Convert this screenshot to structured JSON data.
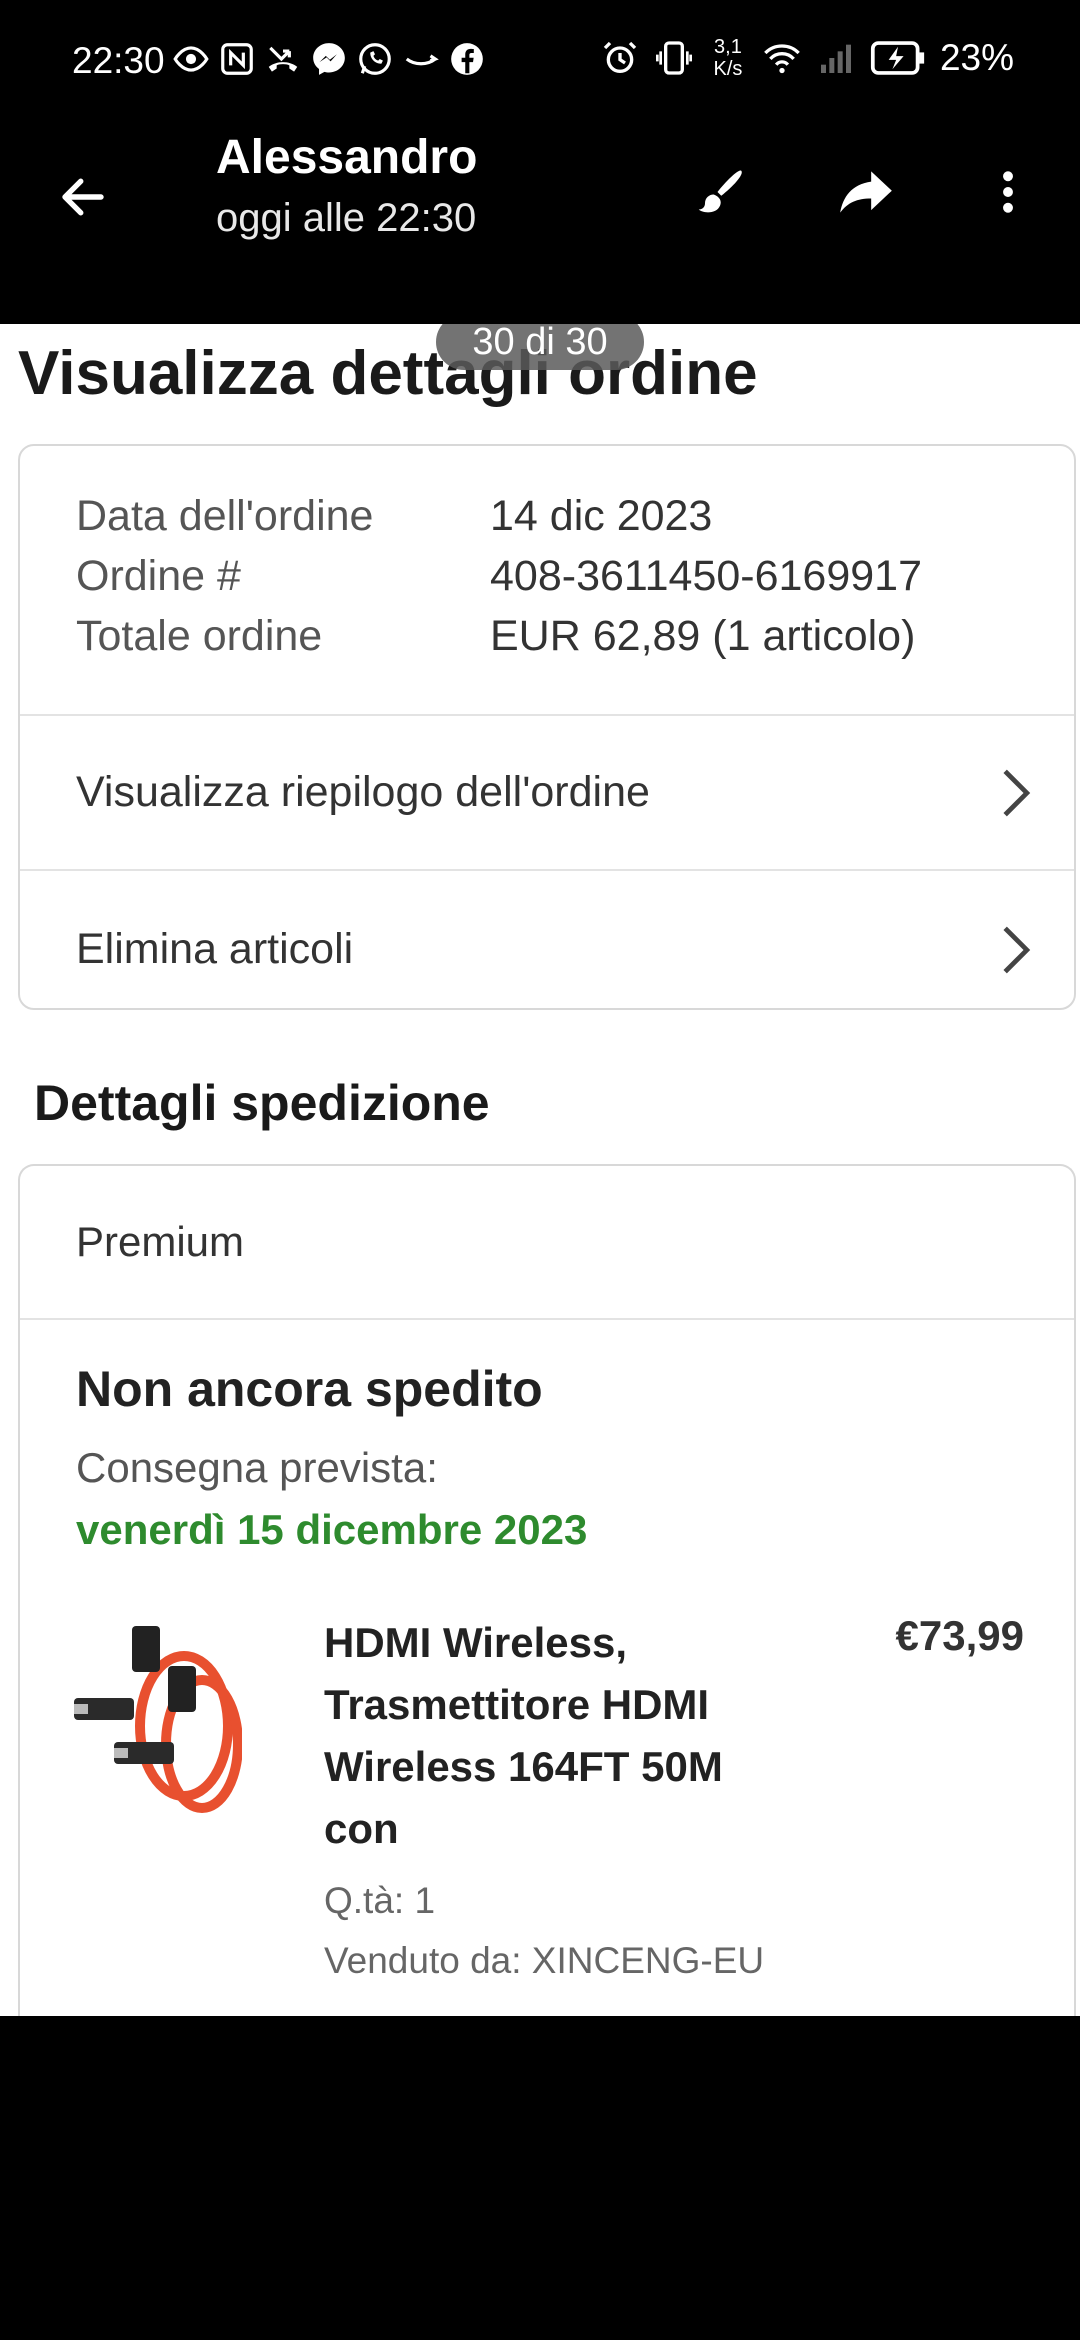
{
  "status_bar": {
    "time": "22:30",
    "net_speed_value": "3,1",
    "net_speed_unit": "K/s",
    "battery_percent": "23%"
  },
  "viewer": {
    "sender_name": "Alessandro",
    "sender_time": "oggi alle 22:30",
    "counter": "30 di 30"
  },
  "order": {
    "page_title": "Visualizza dettagli ordine",
    "date_label": "Data dell'ordine",
    "date_value": "14 dic 2023",
    "number_label": "Ordine #",
    "number_value": "408-3611450-6169917",
    "total_label": "Totale ordine",
    "total_value": "EUR 62,89 (1 articolo)",
    "summary_link": "Visualizza riepilogo dell'ordine",
    "delete_link": "Elimina articoli"
  },
  "shipping": {
    "section_title": "Dettagli spedizione",
    "service": "Premium",
    "status": "Non ancora spedito",
    "delivery_label": "Consegna prevista:",
    "delivery_date": "venerdì 15 dicembre 2023",
    "delivery_date_color": "#2e8b2e"
  },
  "product": {
    "title": "HDMI Wireless, Trasmettitore HDMI Wireless 164FT 50M con",
    "price": "€73,99",
    "qty": "Q.tà: 1",
    "seller": "Venduto da: XINCENG-EU",
    "cable_color": "#e8502f"
  }
}
